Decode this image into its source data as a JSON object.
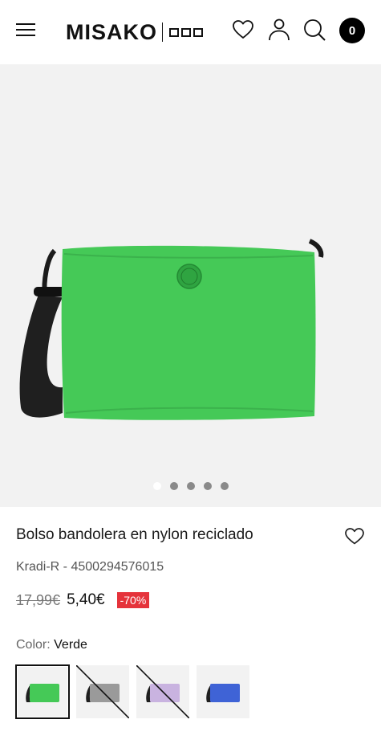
{
  "header": {
    "brand": "MISAKO",
    "cart_count": "0"
  },
  "gallery": {
    "image_count": 5,
    "active_index": 0,
    "bag_color": "#45c957"
  },
  "product": {
    "title": "Bolso bandolera en nylon reciclado",
    "reference": "Kradi-R - 4500294576015",
    "old_price": "17,99€",
    "price": "5,40€",
    "discount": "-70%",
    "color_label": "Color:",
    "color_value": "Verde"
  },
  "swatches": [
    {
      "color_name": "Verde",
      "color": "#45c957",
      "selected": true,
      "available": true
    },
    {
      "color_name": "Gris",
      "color": "#9a9a9a",
      "selected": false,
      "available": false
    },
    {
      "color_name": "Lila",
      "color": "#c9b3e0",
      "selected": false,
      "available": false
    },
    {
      "color_name": "Azul",
      "color": "#3f63d6",
      "selected": false,
      "available": true
    }
  ],
  "colors": {
    "accent": "#000000",
    "discount_bg": "#e5333b",
    "gallery_bg": "#f2f2f2"
  }
}
